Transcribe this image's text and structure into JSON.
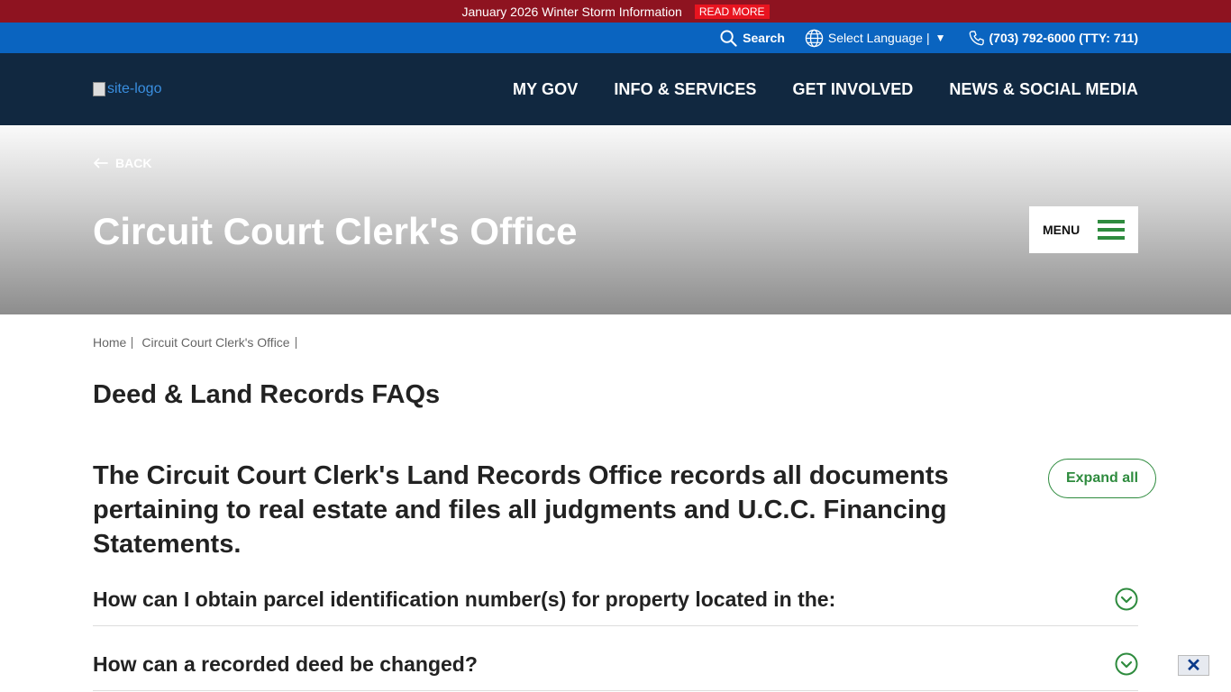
{
  "alert": {
    "text": "January 2026 Winter Storm Information",
    "read_more": "READ MORE"
  },
  "utility": {
    "search_label": "Search",
    "language_label": "Select Language",
    "language_arrow": "▼",
    "phone": "(703) 792-6000 (TTY: 711)"
  },
  "nav": {
    "logo_alt": "site-logo",
    "links": [
      "MY GOV",
      "INFO & SERVICES",
      "GET INVOLVED",
      "NEWS & SOCIAL MEDIA"
    ]
  },
  "hero": {
    "back": "BACK",
    "title": "Circuit Court Clerk's Office",
    "menu": "MENU"
  },
  "breadcrumb": [
    "Home",
    "Circuit Court Clerk's Office"
  ],
  "main": {
    "heading": "Deed & Land Records FAQs",
    "intro": "The Circuit Court Clerk's Land Records Office records all documents pertaining to real estate and files all judgments and U.C.C. Financing Statements.",
    "expand_all": "Expand all",
    "faqs": [
      "How can I obtain parcel identification number(s) for property located in the:",
      "How can a recorded deed be changed?"
    ]
  },
  "close_label": "✕",
  "colors": {
    "alert_bg": "#8e1320",
    "util_bg": "#0a64c0",
    "nav_bg": "#112840",
    "accent_green": "#2e8b3e"
  },
  "icons": [
    "search-icon",
    "globe-icon",
    "phone-icon",
    "arrow-left-icon",
    "hamburger-icon",
    "chevron-down-icon",
    "close-icon"
  ]
}
